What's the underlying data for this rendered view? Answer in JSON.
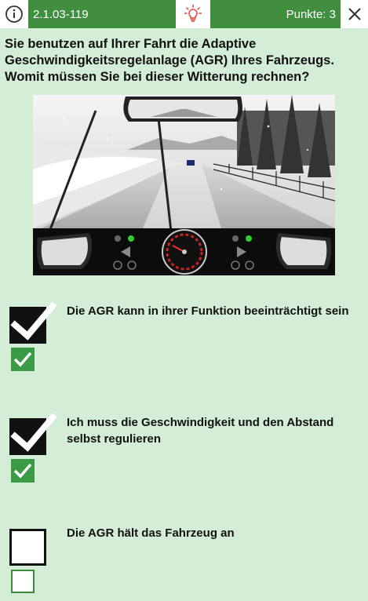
{
  "header": {
    "question_id": "2.1.03-119",
    "points_label": "Punkte: 3",
    "info_icon": "info-icon",
    "hint_icon": "lightbulb-icon",
    "close_icon": "close-icon",
    "accent_color": "#3f8f3f"
  },
  "question": {
    "text": "Sie benutzen auf Ihrer Fahrt die Adaptive Geschwindigkeitsregelanlage (AGR) Ihres Fahrzeugs. Womit müssen Sie bei dieser Witterung rechnen?"
  },
  "answers": [
    {
      "text": "Die AGR kann in ihrer Funktion beeinträchtigt sein",
      "user_checked": true,
      "solution_checked": true
    },
    {
      "text": "Ich muss die Geschwindigkeit und den Abstand selbst regulieren",
      "user_checked": true,
      "solution_checked": true
    },
    {
      "text": "Die AGR hält das Fahrzeug an",
      "user_checked": false,
      "solution_checked": false
    }
  ]
}
